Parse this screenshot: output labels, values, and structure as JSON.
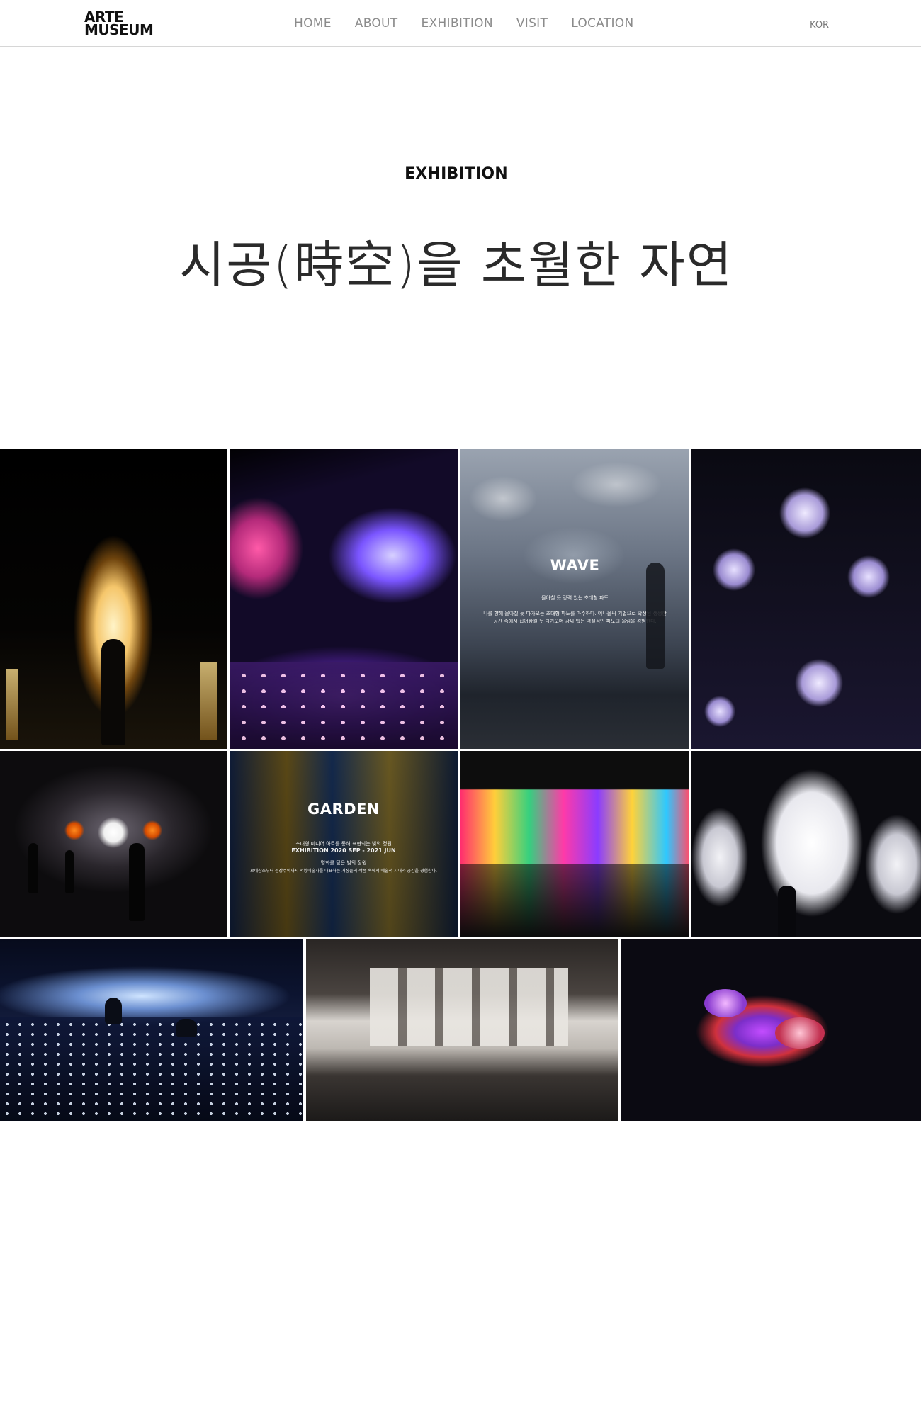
{
  "header": {
    "logo_line1": "ARTE",
    "logo_line2": "MUSEUM",
    "nav": [
      "HOME",
      "ABOUT",
      "EXHIBITION",
      "VISIT",
      "LOCATION"
    ],
    "lang": "KOR"
  },
  "intro": {
    "section_label": "EXHIBITION",
    "headline": "시공(時空)을 초월한 자연"
  },
  "gallery": {
    "wave": {
      "title": "WAVE",
      "subtitle": "몰아칠 듯 강력 있는 초대형 파도",
      "line1": "나를 향해 몰아칠 듯 다가오는 초대형 파도를 마주하다. 어나몰픽 기법으로 확장된 생생한",
      "line2": "공간 속에서 집어삼킬 듯 다가오며 감싸 있는 역설적인 파도의 울림을 경험한다."
    },
    "garden": {
      "title": "GARDEN",
      "line1": "초대형 미디어 아트를 통해 표현되는 빛의 정원",
      "line2": "EXHIBITION 2020 SEP - 2021 JUN",
      "line3": "명화를 담은 빛의 정원",
      "line4": "르네상스부터 성장주의까지 서양미술사를 대표하는 거장들의 작품 속에서 예술적 시대와 공간을 경험한다."
    }
  }
}
